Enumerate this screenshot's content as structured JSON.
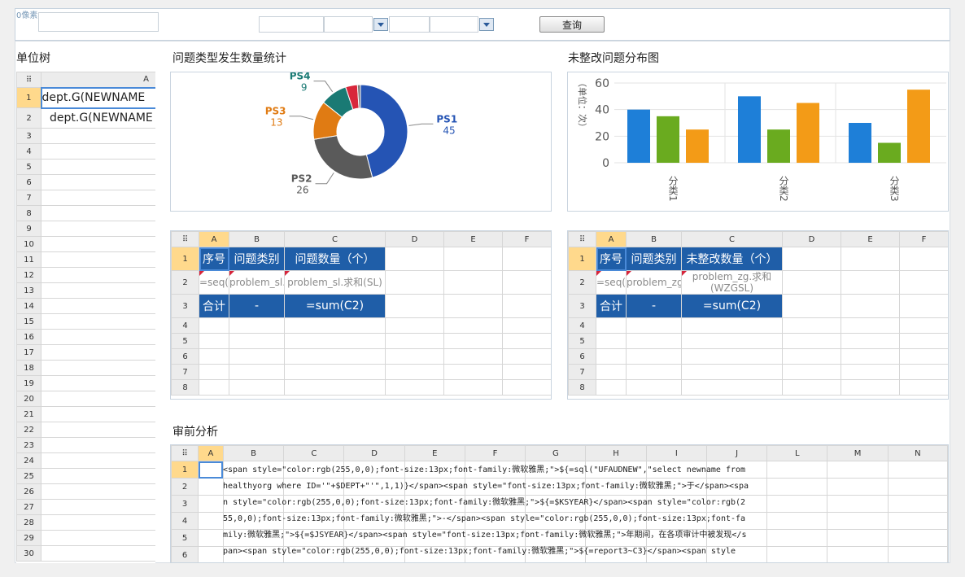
{
  "toolbar": {
    "corner_tag": "0像素",
    "query_label": "查询",
    "inputs": [
      "",
      "",
      "",
      "",
      ""
    ]
  },
  "titles": {
    "tree": "单位树",
    "pie": "问题类型发生数量统计",
    "bar": "未整改问题分布图",
    "analysis": "审前分析"
  },
  "tree": {
    "col": "A",
    "rows": [
      "1",
      "2",
      "3",
      "4",
      "5",
      "6",
      "7",
      "8",
      "9",
      "10",
      "11",
      "12",
      "13",
      "14",
      "15",
      "16",
      "17",
      "18",
      "19",
      "20",
      "21",
      "22",
      "23",
      "24",
      "25",
      "26",
      "27",
      "28",
      "29",
      "30"
    ],
    "cell1": "dept.G(NEWNAME",
    "cell2": "dept.G(NEWNAME"
  },
  "table1": {
    "cols": [
      "A",
      "B",
      "C",
      "D",
      "E",
      "F"
    ],
    "rows": [
      "1",
      "2",
      "3",
      "4",
      "5",
      "6",
      "7",
      "8"
    ],
    "h1": "序号",
    "h2": "问题类别",
    "h3": "问题数量（个）",
    "f1": "=seq()",
    "f2": "problem_sl.G(SORT",
    "f3": "problem_sl.求和(SL)",
    "t1": "合计",
    "t2": "-",
    "t3": "=sum(C2)"
  },
  "table2": {
    "cols": [
      "A",
      "B",
      "C",
      "D",
      "E",
      "F"
    ],
    "rows": [
      "1",
      "2",
      "3",
      "4",
      "5",
      "6",
      "7",
      "8"
    ],
    "h1": "序号",
    "h2": "问题类别",
    "h3": "未整改数量（个）",
    "f1": "=seq()",
    "f2": "problem_zg.G(SORT,BIG",
    "f3": "problem_zg.求和(WZGSL)",
    "t1": "合计",
    "t2": "-",
    "t3": "=sum(C2)"
  },
  "analysis": {
    "cols": [
      "A",
      "B",
      "C",
      "D",
      "E",
      "F",
      "G",
      "H",
      "I",
      "J",
      "L",
      "M",
      "N"
    ],
    "rows": [
      "1",
      "2",
      "3",
      "4",
      "5",
      "6"
    ],
    "text": "<span style=\"color:rgb(255,0,0);font-size:13px;font-family:微软雅黑;\">${=sql(\"UFAUDNEW\",\"select newname from healthyorg where ID='\"+$DEPT+\"'\",1,1)}</span><span style=\"font-size:13px;font-family:微软雅黑;\">于</span><span style=\"color:rgb(255,0,0);font-size:13px;font-family:微软雅黑;\">${=$KSYEAR}</span><span style=\"color:rgb(255,0,0);font-size:13px;font-family:微软雅黑;\">-</span><span style=\"color:rgb(255,0,0);font-size:13px;font-family:微软雅黑;\">${=$JSYEAR}</span><span style=\"font-size:13px;font-family:微软雅黑;\">年期间，在各项审计中被发现</span><span style=\"color:rgb(255,0,0);font-size:13px;font-family:微软雅黑;\">${=report3~C3}</span><span style=\"font-size:13px;font-family:微软雅黑;\">个问题，涉及金额</span><span style=\"color:rgb(255,0,0);font-size:13px;font-family:微软雅黑;\">${=report4~C3}</span><span style=\"font-size:13px;font-family:微软雅黑;\">元，审前阶段分析如下：</span>"
  },
  "pie_chart": {
    "type": "pie",
    "slices": [
      {
        "name": "PS1",
        "value": 45,
        "color": "#2554b4"
      },
      {
        "name": "PS2",
        "value": 26,
        "color": "#5a5a5a"
      },
      {
        "name": "PS3",
        "value": 13,
        "color": "#e07b13"
      },
      {
        "name": "PS4",
        "value": 9,
        "color": "#1a7a74"
      },
      {
        "name": "",
        "value": 4,
        "color": "#d8273b"
      },
      {
        "name": "",
        "value": 1,
        "color": "#7a7a7a"
      }
    ]
  },
  "chart_data": {
    "type": "bar",
    "categories": [
      "分类1",
      "分类2",
      "分类3"
    ],
    "series": [
      {
        "values": [
          40,
          50,
          30
        ],
        "color": "#1e7fd8"
      },
      {
        "values": [
          35,
          25,
          15
        ],
        "color": "#6aab1f"
      },
      {
        "values": [
          25,
          45,
          55
        ],
        "color": "#f39b17"
      }
    ],
    "ylabel": "（单位：次）",
    "ylim": [
      0,
      60
    ],
    "yticks": [
      "0",
      "20",
      "40",
      "60"
    ]
  }
}
